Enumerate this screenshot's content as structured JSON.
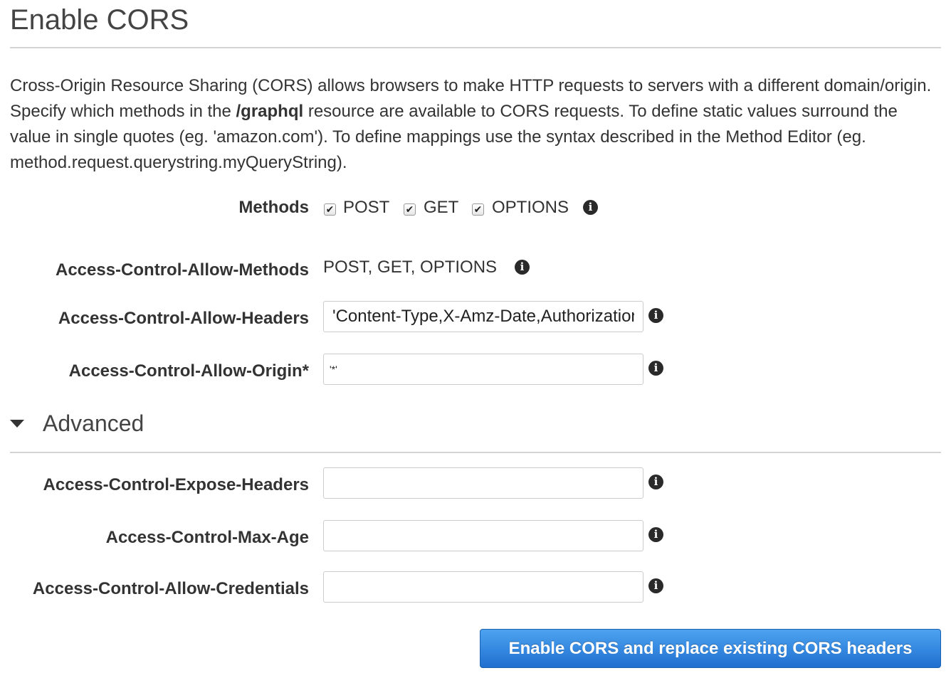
{
  "page": {
    "title": "Enable CORS",
    "description": {
      "part1": "Cross-Origin Resource Sharing (CORS) allows browsers to make HTTP requests to servers with a different domain/origin. Specify which methods in the ",
      "resource": "/graphql",
      "part2": " resource are available to CORS requests. To define static values surround the value in single quotes (eg. 'amazon.com'). To define mappings use the syntax described in the Method Editor (eg. method.request.querystring.myQueryString)."
    }
  },
  "methods": {
    "label": "Methods",
    "options": [
      {
        "label": "POST",
        "checked": true
      },
      {
        "label": "GET",
        "checked": true
      },
      {
        "label": "OPTIONS",
        "checked": true
      }
    ]
  },
  "fields": {
    "allow_methods": {
      "label": "Access-Control-Allow-Methods",
      "value": "POST, GET, OPTIONS"
    },
    "allow_headers": {
      "label": "Access-Control-Allow-Headers",
      "value": "'Content-Type,X-Amz-Date,Authorization,X-Api-Key,X-Amz-Security-Token'"
    },
    "allow_origin": {
      "label": "Access-Control-Allow-Origin*",
      "value": "'*'"
    }
  },
  "advanced": {
    "title": "Advanced",
    "expanded": true,
    "fields": {
      "expose_headers": {
        "label": "Access-Control-Expose-Headers",
        "value": ""
      },
      "max_age": {
        "label": "Access-Control-Max-Age",
        "value": ""
      },
      "allow_credentials": {
        "label": "Access-Control-Allow-Credentials",
        "value": ""
      }
    }
  },
  "actions": {
    "submit_label": "Enable CORS and replace existing CORS headers"
  },
  "icons": {
    "info": "info-icon",
    "caret": "caret-down-icon",
    "check": "check-icon"
  },
  "colors": {
    "button_top": "#4da3f0",
    "button_bottom": "#1f6fd0",
    "divider": "#d4d4d4"
  }
}
